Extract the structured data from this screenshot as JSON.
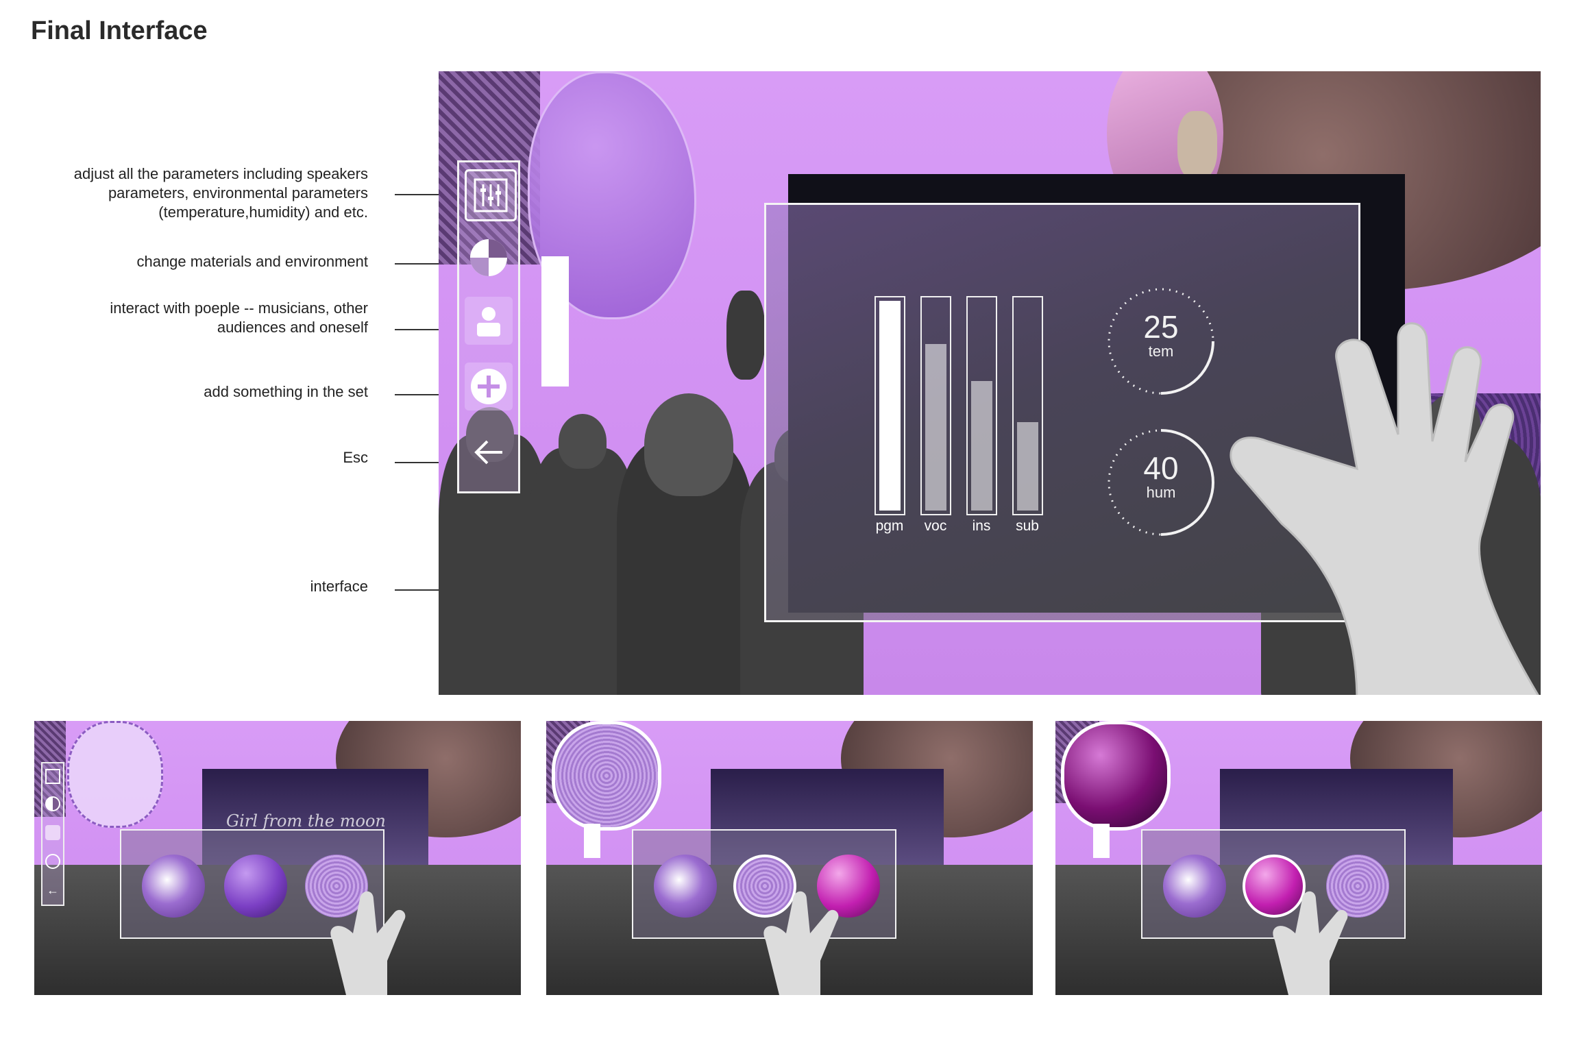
{
  "page": {
    "title": "Final Interface"
  },
  "annotations": {
    "adjust": "adjust all the parameters including speakers\nparameters, environmental parameters\n(temperature,humidity) and etc.",
    "materials": "change materials and environment",
    "people": "interact with poeple -- musicians, other\naudiences and oneself",
    "add": "add something in the set",
    "esc": "Esc",
    "interface": "interface"
  },
  "toolbar": {
    "items": [
      {
        "name": "mixer-icon",
        "active": true
      },
      {
        "name": "material-icon",
        "active": false
      },
      {
        "name": "person-icon",
        "active": false
      },
      {
        "name": "add-icon",
        "active": false
      },
      {
        "name": "back-arrow-icon",
        "active": false
      }
    ]
  },
  "mixer": {
    "channels": [
      {
        "label": "pgm",
        "level": 1.0
      },
      {
        "label": "voc",
        "level": 0.8
      },
      {
        "label": "ins",
        "level": 0.63
      },
      {
        "label": "sub",
        "level": 0.44
      }
    ]
  },
  "environment": {
    "temperature": {
      "value": "25",
      "label": "tem"
    },
    "humidity": {
      "value": "40",
      "label": "hum"
    }
  },
  "thumbnails": [
    {
      "caption": "Girl from the moon",
      "spheres": [
        "marble",
        "purple-glossy",
        "purple-knit"
      ],
      "selected": 2
    },
    {
      "caption": "",
      "spheres": [
        "marble",
        "purple-knit",
        "magenta-glossy"
      ],
      "selected": 1
    },
    {
      "caption": "",
      "spheres": [
        "marble",
        "magenta-glossy",
        "purple-knit"
      ],
      "selected": 1
    }
  ],
  "colors": {
    "accent": "#d494f5",
    "panel_border": "#f2f2f2",
    "crowd": "#404040"
  }
}
